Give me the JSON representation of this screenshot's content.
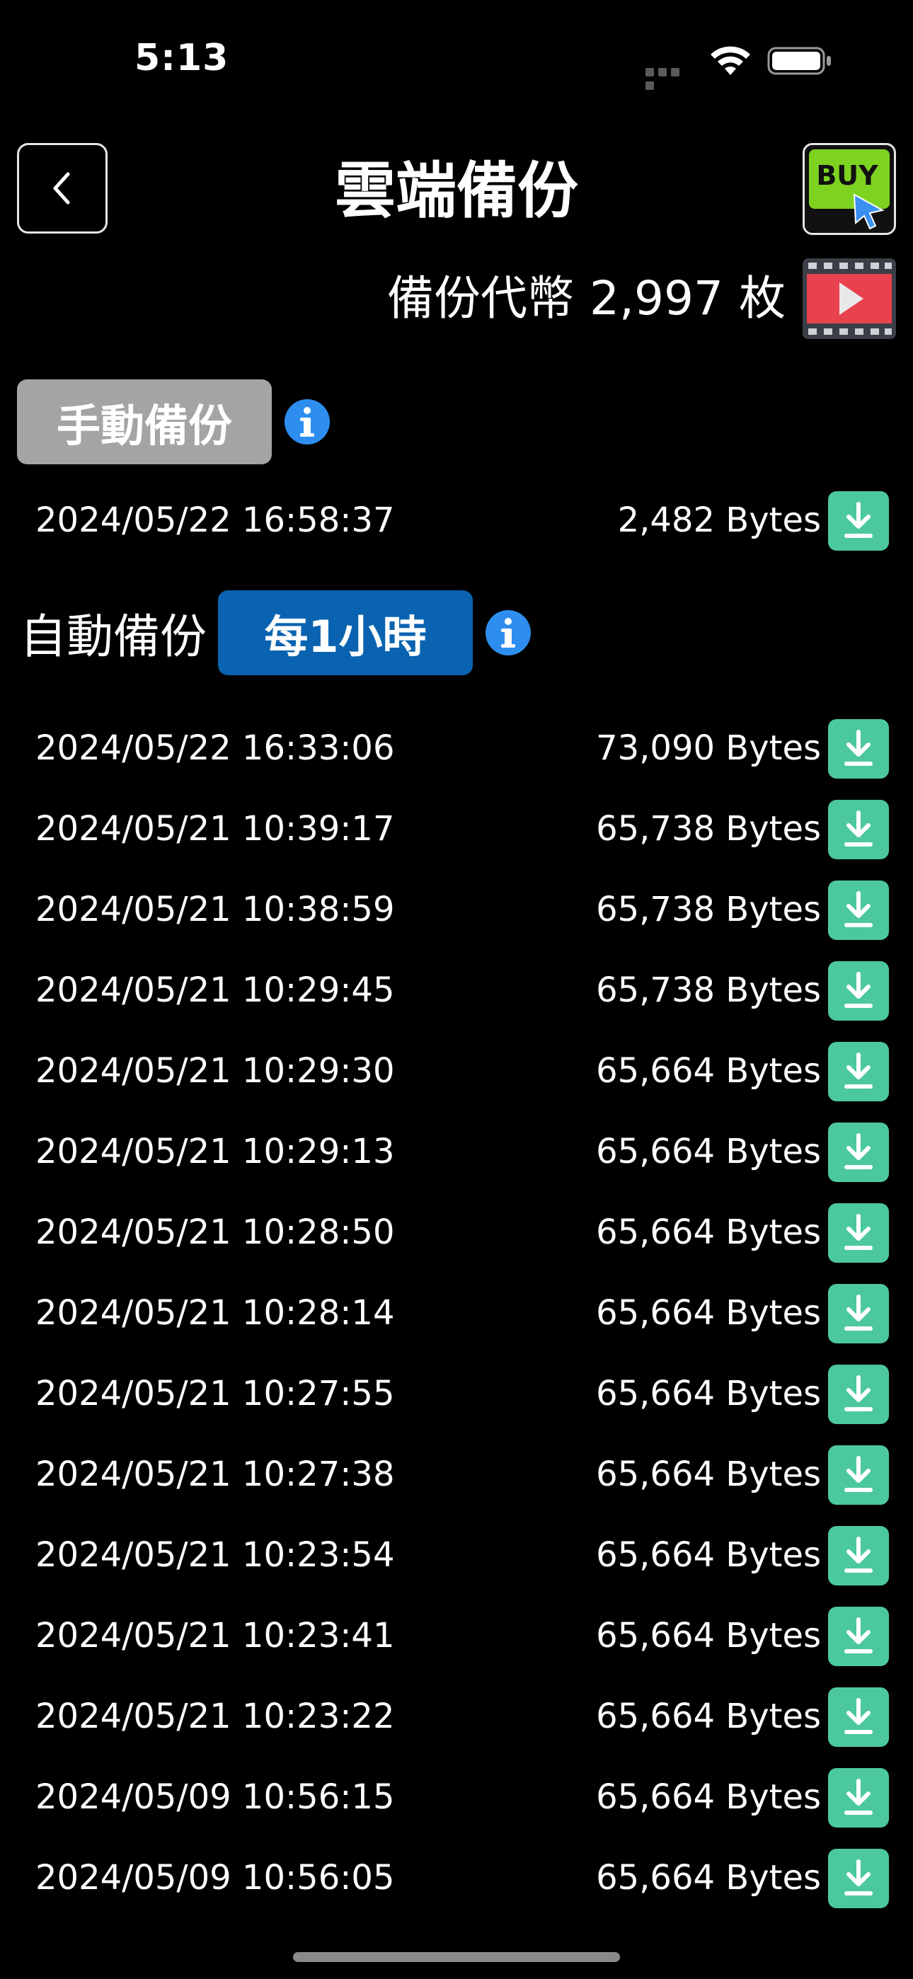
{
  "status_bar": {
    "time": "5:13"
  },
  "header": {
    "title": "雲端備份",
    "buy_badge": "BUY"
  },
  "tokens": {
    "label": "備份代幣",
    "count": "2,997",
    "unit": "枚"
  },
  "manual_backup": {
    "label": "手動備份",
    "entries": [
      {
        "date": "2024/05/22 16:58:37",
        "size": "2,482 Bytes"
      }
    ]
  },
  "auto_backup": {
    "label": "自動備份",
    "interval_label": "每1小時",
    "entries": [
      {
        "date": "2024/05/22 16:33:06",
        "size": "73,090 Bytes"
      },
      {
        "date": "2024/05/21 10:39:17",
        "size": "65,738 Bytes"
      },
      {
        "date": "2024/05/21 10:38:59",
        "size": "65,738 Bytes"
      },
      {
        "date": "2024/05/21 10:29:45",
        "size": "65,738 Bytes"
      },
      {
        "date": "2024/05/21 10:29:30",
        "size": "65,664 Bytes"
      },
      {
        "date": "2024/05/21 10:29:13",
        "size": "65,664 Bytes"
      },
      {
        "date": "2024/05/21 10:28:50",
        "size": "65,664 Bytes"
      },
      {
        "date": "2024/05/21 10:28:14",
        "size": "65,664 Bytes"
      },
      {
        "date": "2024/05/21 10:27:55",
        "size": "65,664 Bytes"
      },
      {
        "date": "2024/05/21 10:27:38",
        "size": "65,664 Bytes"
      },
      {
        "date": "2024/05/21 10:23:54",
        "size": "65,664 Bytes"
      },
      {
        "date": "2024/05/21 10:23:41",
        "size": "65,664 Bytes"
      },
      {
        "date": "2024/05/21 10:23:22",
        "size": "65,664 Bytes"
      },
      {
        "date": "2024/05/09 10:56:15",
        "size": "65,664 Bytes"
      },
      {
        "date": "2024/05/09 10:56:05",
        "size": "65,664 Bytes"
      }
    ]
  },
  "colors": {
    "background": "#000000",
    "manual_label_bg": "#a4a4a4",
    "interval_button_bg": "#0a63b0",
    "download_button_bg": "#4cc8a0",
    "info_icon": "#2d8ef0"
  }
}
